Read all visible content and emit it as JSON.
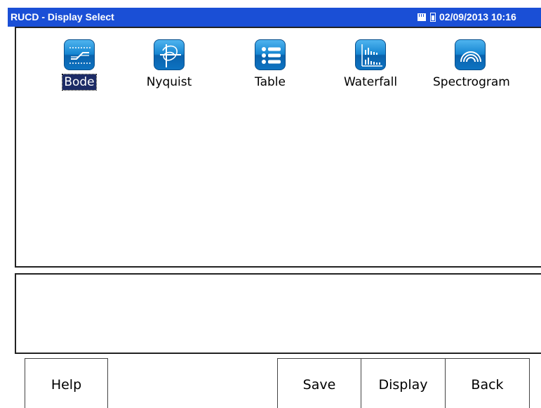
{
  "window": {
    "title": "RUCD - Display Select",
    "datetime": "02/09/2013 10:16"
  },
  "status_icons": [
    "sd-card-icon",
    "battery-icon"
  ],
  "displays": [
    {
      "label": "Bode",
      "icon": "bode-plot-icon",
      "selected": true
    },
    {
      "label": "Nyquist",
      "icon": "nyquist-plot-icon",
      "selected": false
    },
    {
      "label": "Table",
      "icon": "table-list-icon",
      "selected": false
    },
    {
      "label": "Waterfall",
      "icon": "waterfall-bars-icon",
      "selected": false
    },
    {
      "label": "Spectrogram",
      "icon": "spectrogram-arcs-icon",
      "selected": false
    }
  ],
  "buttons": {
    "help": "Help",
    "save": "Save",
    "display": "Display",
    "back": "Back"
  },
  "colors": {
    "titlebar": "#1a4fd6",
    "selection": "#1c2b66",
    "icon_blue": "#1585d1"
  }
}
